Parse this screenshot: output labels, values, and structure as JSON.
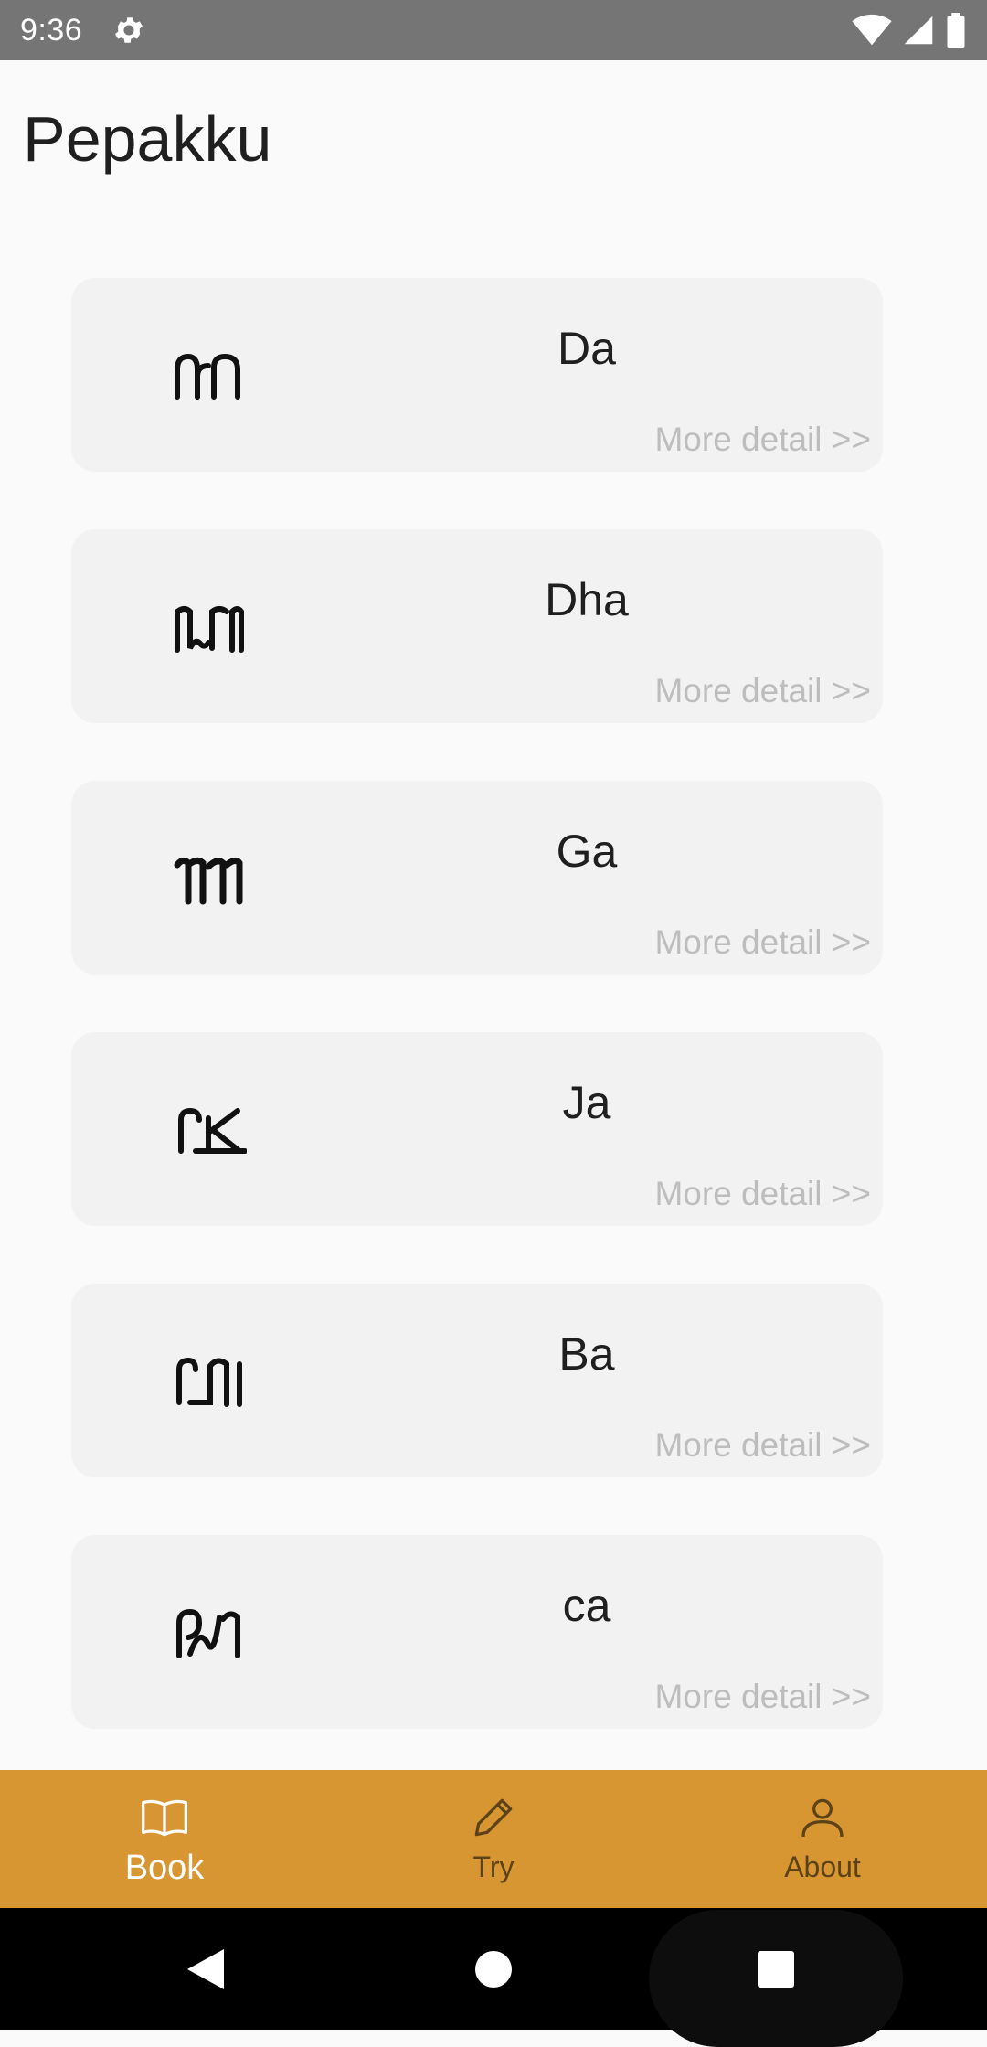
{
  "status_bar": {
    "time": "9:36",
    "icons": [
      "gear-icon",
      "wifi-icon",
      "signal-icon",
      "battery-icon"
    ]
  },
  "app": {
    "title": "Pepakku"
  },
  "letters": [
    {
      "glyph_icon": "javanese-da-glyph",
      "name": "Da",
      "detail": "More detail >>"
    },
    {
      "glyph_icon": "javanese-dha-glyph",
      "name": "Dha",
      "detail": "More detail >>"
    },
    {
      "glyph_icon": "javanese-ga-glyph",
      "name": "Ga",
      "detail": "More detail >>"
    },
    {
      "glyph_icon": "javanese-ja-glyph",
      "name": "Ja",
      "detail": "More detail >>"
    },
    {
      "glyph_icon": "javanese-ba-glyph",
      "name": "Ba",
      "detail": "More detail >>"
    },
    {
      "glyph_icon": "javanese-ca-glyph",
      "name": "ca",
      "detail": "More detail >>"
    }
  ],
  "bottom_nav": {
    "items": [
      {
        "label": "Book",
        "icon": "book-icon",
        "active": true
      },
      {
        "label": "Try",
        "icon": "pencil-icon",
        "active": false
      },
      {
        "label": "About",
        "icon": "person-icon",
        "active": false
      }
    ]
  },
  "colors": {
    "status_bar": "#757575",
    "nav_bar": "#d89632",
    "card": "#f2f2f2",
    "detail_text": "#bdbdbd"
  }
}
